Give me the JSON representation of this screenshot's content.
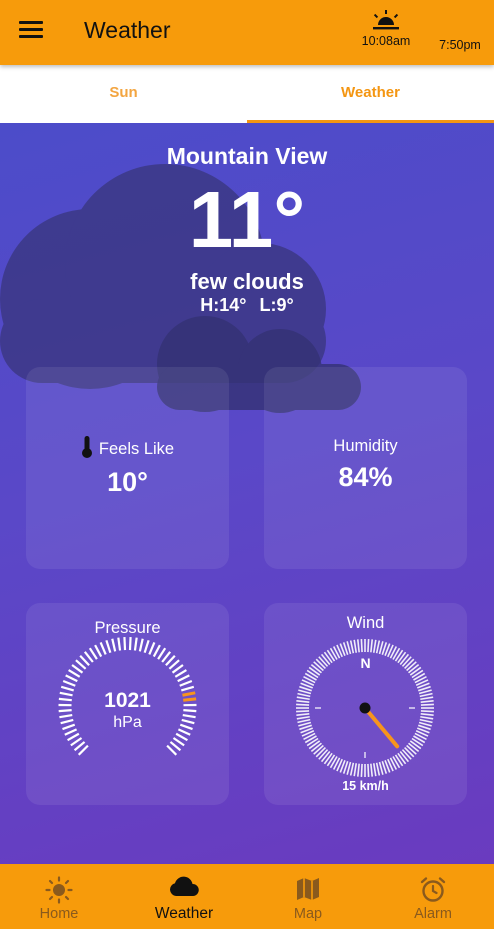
{
  "app_bar": {
    "title": "Weather",
    "sunrise_time": "10:08am",
    "sunset_time": "7:50pm"
  },
  "tabs": [
    {
      "label": "Sun"
    },
    {
      "label": "Weather"
    }
  ],
  "current": {
    "city": "Mountain View",
    "temperature": "11°",
    "description": "few clouds",
    "high": "H:14°",
    "low": "L:9°"
  },
  "cards": {
    "feels_like": {
      "title": "Feels Like",
      "value": "10°"
    },
    "humidity": {
      "title": "Humidity",
      "value": "84%"
    },
    "pressure": {
      "title": "Pressure",
      "value": "1021",
      "unit": "hPa",
      "gauge_fraction": 0.8
    },
    "wind": {
      "title": "Wind",
      "north_label": "N",
      "speed": "15 km/h",
      "direction_deg": 140
    }
  },
  "bottom_nav": [
    {
      "label": "Home",
      "icon": "sun-icon"
    },
    {
      "label": "Weather",
      "icon": "cloud-icon"
    },
    {
      "label": "Map",
      "icon": "map-icon"
    },
    {
      "label": "Alarm",
      "icon": "alarm-icon"
    }
  ],
  "colors": {
    "accent": "#f79b0b",
    "tab_active": "#f49612",
    "background": "#5a48c8"
  }
}
